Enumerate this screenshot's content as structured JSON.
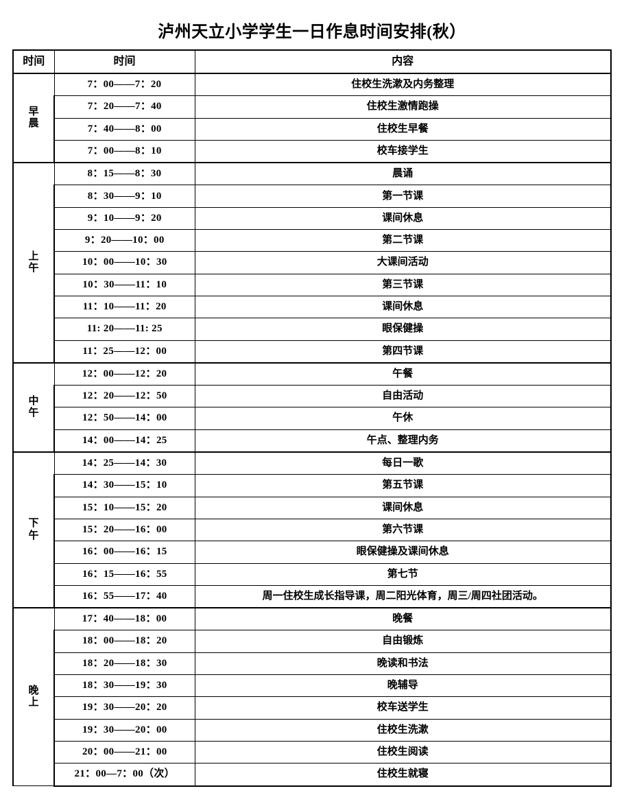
{
  "document": {
    "title": "泸州天立小学学生一日作息时间安排(秋）"
  },
  "table": {
    "headers": {
      "period": "时间",
      "time": "时间",
      "content": "内容"
    },
    "groups": [
      {
        "label": "早晨",
        "label_chars": [
          "早",
          "晨"
        ],
        "rows": [
          {
            "time": "7：00——7：20",
            "content": "住校生洗漱及内务整理"
          },
          {
            "time": "7：20——7：40",
            "content": "住校生激情跑操"
          },
          {
            "time": "7：40——8：00",
            "content": "住校生早餐"
          },
          {
            "time": "7：00——8：10",
            "content": "校车接学生"
          }
        ]
      },
      {
        "label": "上午",
        "label_chars": [
          "上",
          "午"
        ],
        "rows": [
          {
            "time": "8：15——8：30",
            "content": "晨诵"
          },
          {
            "time": "8：30——9：10",
            "content": "第一节课"
          },
          {
            "time": "9：10——9：20",
            "content": "课间休息"
          },
          {
            "time": "9：20——10：00",
            "content": "第二节课"
          },
          {
            "time": "10：00——10：30",
            "content": "大课间活动"
          },
          {
            "time": "10：30——11：10",
            "content": "第三节课"
          },
          {
            "time": "11：10——11：20",
            "content": "课间休息"
          },
          {
            "time": "11: 20——11: 25",
            "content": "眼保健操"
          },
          {
            "time": "11：25——12：00",
            "content": "第四节课"
          }
        ]
      },
      {
        "label": "中午",
        "label_chars": [
          "中",
          "午"
        ],
        "rows": [
          {
            "time": "12：00——12：20",
            "content": "午餐"
          },
          {
            "time": "12：20——12：50",
            "content": "自由活动"
          },
          {
            "time": "12：50——14：00",
            "content": "午休"
          },
          {
            "time": "14：00——14：25",
            "content": "午点、整理内务"
          }
        ]
      },
      {
        "label": "下午",
        "label_chars": [
          "下",
          "午"
        ],
        "rows": [
          {
            "time": "14：25——14：30",
            "content": "每日一歌"
          },
          {
            "time": "14：30——15：10",
            "content": "第五节课"
          },
          {
            "time": "15：10——15：20",
            "content": "课间休息"
          },
          {
            "time": "15：20——16：00",
            "content": "第六节课"
          },
          {
            "time": "16：00——16：15",
            "content": "眼保健操及课间休息"
          },
          {
            "time": "16：15——16：55",
            "content": "第七节"
          },
          {
            "time": "16：55——17：40",
            "content": "周一住校生成长指导课，周二阳光体育，周三/周四社团活动。"
          }
        ]
      },
      {
        "label": "晚上",
        "label_chars": [
          "晚",
          "上"
        ],
        "rows": [
          {
            "time": "17：40——18：00",
            "content": "晚餐"
          },
          {
            "time": "18：00——18：20",
            "content": "自由锻炼"
          },
          {
            "time": "18：20——18：30",
            "content": "晚读和书法"
          },
          {
            "time": "18：30——19：30",
            "content": "晚辅导"
          },
          {
            "time": "19：30——20：20",
            "content": "校车送学生"
          },
          {
            "time": "19：30——20：00",
            "content": "住校生洗漱"
          },
          {
            "time": "20：00——21：00",
            "content": "住校生阅读"
          },
          {
            "time": "21：00—7：00（次）",
            "content": "住校生就寝"
          }
        ]
      }
    ]
  }
}
